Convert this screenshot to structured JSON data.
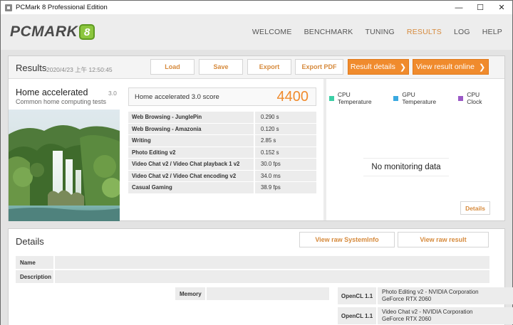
{
  "window": {
    "title": "PCMark 8 Professional Edition",
    "minimize": "—",
    "maximize": "☐",
    "close": "✕"
  },
  "logo": {
    "text": "PCMARK",
    "badge": "8"
  },
  "nav": {
    "welcome": "WELCOME",
    "benchmark": "BENCHMARK",
    "tuning": "TUNING",
    "results": "RESULTS",
    "log": "LOG",
    "help": "HELP"
  },
  "results": {
    "title": "Results",
    "date": "2020/4/23 上午 12:50:45",
    "buttons": {
      "load": "Load",
      "save": "Save",
      "export": "Export",
      "export_pdf": "Export PDF",
      "result_details": "Result details",
      "view_online": "View result online",
      "chevron": "❯"
    },
    "benchmark": {
      "name": "Home accelerated",
      "version": "3.0",
      "description": "Common home computing tests"
    },
    "score": {
      "label": "Home accelerated 3.0 score",
      "value": "4400"
    },
    "subtests": [
      {
        "name": "Web Browsing - JunglePin",
        "value": "0.290 s"
      },
      {
        "name": "Web Browsing - Amazonia",
        "value": "0.120 s"
      },
      {
        "name": "Writing",
        "value": "2.85 s"
      },
      {
        "name": "Photo Editing v2",
        "value": "0.152 s"
      },
      {
        "name": "Video Chat v2 / Video Chat playback 1 v2",
        "value": "30.0 fps"
      },
      {
        "name": "Video Chat v2 / Video Chat encoding v2",
        "value": "34.0 ms"
      },
      {
        "name": "Casual Gaming",
        "value": "38.9 fps"
      }
    ],
    "monitoring": {
      "legend": [
        {
          "label": "CPU Temperature",
          "color": "#3ccfa6"
        },
        {
          "label": "GPU Temperature",
          "color": "#3aa9e0"
        },
        {
          "label": "CPU Clock",
          "color": "#9b59c6"
        }
      ],
      "no_data": "No monitoring data",
      "details_button": "Details"
    }
  },
  "details": {
    "title": "Details",
    "view_raw_systeminfo": "View raw SystemInfo",
    "view_raw_result": "View raw result",
    "name_label": "Name",
    "description_label": "Description",
    "memory_label": "Memory",
    "opencl": [
      {
        "label": "OpenCL 1.1",
        "line1": "Photo Editing v2 - NVIDIA Corporation",
        "line2": "GeForce RTX 2060"
      },
      {
        "label": "OpenCL 1.1",
        "line1": "Video Chat v2 - NVIDIA Corporation",
        "line2": "GeForce RTX 2060"
      }
    ]
  },
  "colors": {
    "accent": "#f08b2d",
    "accent_text": "#d68a3c",
    "logo_green": "#8cc63e"
  }
}
